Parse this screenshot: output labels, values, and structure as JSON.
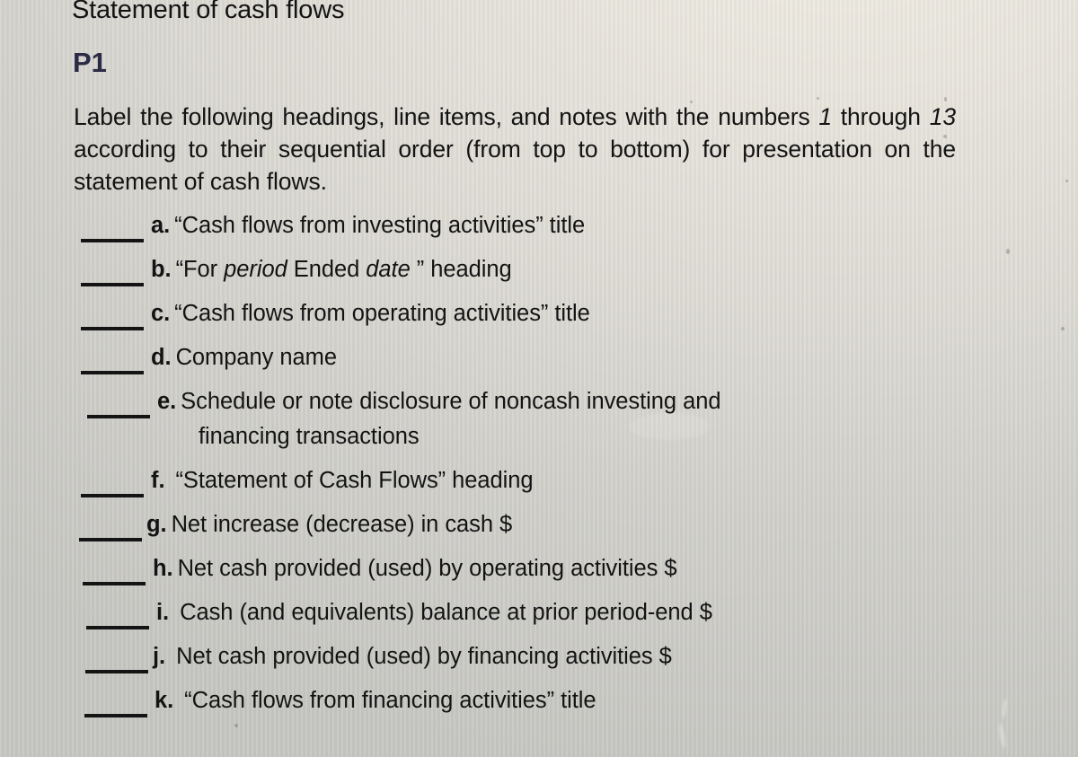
{
  "document": {
    "title": "Statement of cash flows",
    "problem_code": "P1",
    "instructions": {
      "line1_a": "Label the following headings, line items, and notes with the numbers ",
      "line1_em": "1",
      "line2_a": "through ",
      "line2_em": "13",
      "line2_b": " according to their sequential order (from top to bottom) for",
      "line3": "presentation on the statement of cash flows.",
      "full_text": "Label the following headings, line items, and notes with the numbers 1 through 13 according to their sequential order (from top to bottom) for presentation on the statement of cash flows."
    },
    "answer_blank": "_____",
    "items": [
      {
        "letter": "a.",
        "text": "“Cash flows from investing activities” title"
      },
      {
        "letter": "b.",
        "text_pre": "“For ",
        "em1": "period",
        "text_mid": " Ended ",
        "em2": "date",
        "text_post": " ” heading",
        "text": "“For period Ended date ” heading"
      },
      {
        "letter": "c.",
        "text": "“Cash flows from operating activities” title"
      },
      {
        "letter": "d.",
        "text": "Company name"
      },
      {
        "letter": "e.",
        "text": "Schedule or note disclosure of noncash investing and",
        "text_line2": "financing transactions",
        "text_full": "Schedule or note disclosure of noncash investing and financing transactions"
      },
      {
        "letter": "f.",
        "text": "“Statement of Cash Flows” heading"
      },
      {
        "letter": "g.",
        "text": "Net increase (decrease) in cash $"
      },
      {
        "letter": "h.",
        "text": "Net cash provided (used) by operating activities $"
      },
      {
        "letter": "i.",
        "text": "Cash (and equivalents) balance at prior period-end $"
      },
      {
        "letter": "j.",
        "text": "Net cash provided (used) by financing activities $"
      },
      {
        "letter": "k.",
        "text": "“Cash flows from financing activities” title"
      }
    ]
  },
  "colors": {
    "text": "#131313",
    "problem_code": "#2b2b46",
    "paper": "#dedcd5",
    "rule": "#141414"
  }
}
